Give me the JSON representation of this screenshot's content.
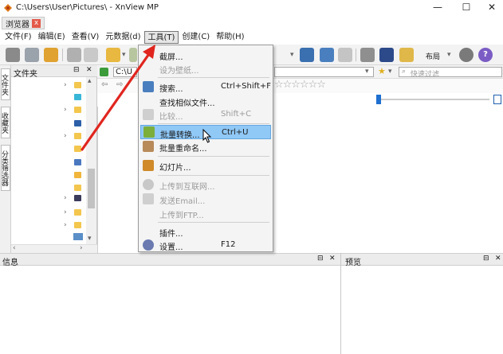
{
  "window": {
    "title": "C:\\Users\\User\\Pictures\\ - XnView MP",
    "minimize": "—",
    "maximize": "☐",
    "close": "✕"
  },
  "tabs": [
    {
      "label": "浏览器",
      "close": "x"
    }
  ],
  "menu": [
    "文件(F)",
    "编辑(E)",
    "查看(V)",
    "元数据(d)",
    "工具(T)",
    "创建(C)",
    "帮助(H)"
  ],
  "toolbar": {
    "layout_label": "布局",
    "help": "?"
  },
  "sidebar": {
    "tabs": [
      "文件夹",
      "收藏夹",
      "分类筛选器"
    ]
  },
  "folders_panel": {
    "title": "文件夹",
    "pin": "⊟",
    "close": "✕"
  },
  "path": {
    "value": "C:\\U"
  },
  "search": {
    "placeholder": "快速过滤"
  },
  "tools_menu": {
    "items": [
      {
        "label": "截屏...",
        "shortcut": "",
        "disabled": false
      },
      {
        "label": "设为壁纸...",
        "shortcut": "",
        "disabled": true
      },
      {
        "label": "搜索...",
        "shortcut": "Ctrl+Shift+F",
        "disabled": false
      },
      {
        "label": "查找相似文件...",
        "shortcut": "",
        "disabled": false
      },
      {
        "label": "比较...",
        "shortcut": "Shift+C",
        "disabled": true
      },
      {
        "label": "批量转换...",
        "shortcut": "Ctrl+U",
        "disabled": false,
        "highlighted": true
      },
      {
        "label": "批量重命名...",
        "shortcut": "",
        "disabled": false
      },
      {
        "label": "幻灯片...",
        "shortcut": "",
        "disabled": false
      },
      {
        "label": "上传到互联网...",
        "shortcut": "",
        "disabled": true
      },
      {
        "label": "发送Email...",
        "shortcut": "",
        "disabled": true
      },
      {
        "label": "上传到FTP...",
        "shortcut": "",
        "disabled": true
      },
      {
        "label": "插件...",
        "shortcut": "",
        "disabled": false
      },
      {
        "label": "设置...",
        "shortcut": "F12",
        "disabled": false
      }
    ]
  },
  "bottom_panels": {
    "info": "信息",
    "preview": "预览",
    "pin": "⊟",
    "close": "✕"
  },
  "colors": {
    "accent": "#90c8f6",
    "arrow": "#e0261f",
    "folder": "#f3c64d"
  }
}
